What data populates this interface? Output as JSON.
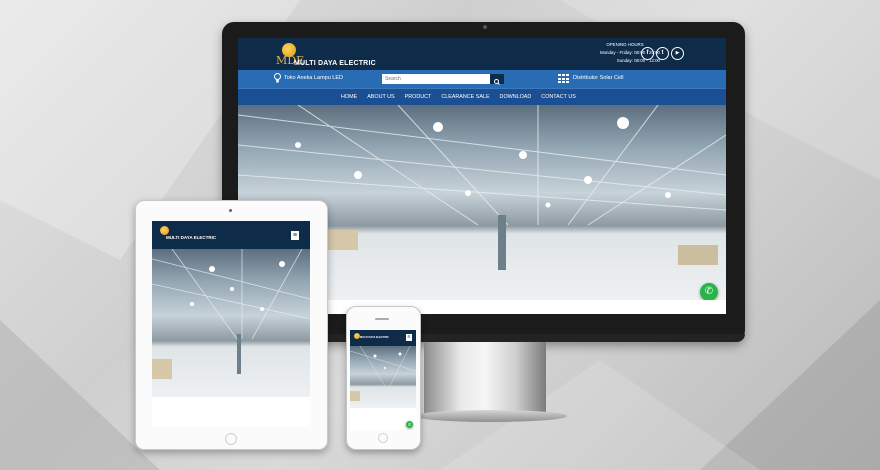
{
  "site": {
    "logo_mark": "MDE",
    "brand": "MULTI DAYA ELECTRIC",
    "opening_hours_title": "OPENING HOURS",
    "hours_weekday": "Monday - Friday: 08:00 - 20:00",
    "hours_sunday": "Sunday: 08:00 - 12:00",
    "social": [
      "facebook-icon",
      "twitter-icon",
      "youtube-icon"
    ],
    "tagline": "Toko Aneka Lampu LED",
    "search_placeholder": "Search",
    "solar_link": "Distributor Solar Cell",
    "nav": [
      "HOME",
      "ABOUT US",
      "PRODUCT",
      "CLEARANCE SALE",
      "DOWNLOAD",
      "CONTACT US"
    ]
  },
  "tablet": {
    "brand": "MULTI DAYA ELECTRIC",
    "menu_glyph": "≡"
  },
  "phone": {
    "brand": "MULTI DAYA ELECTRIC",
    "menu_glyph": "≡"
  },
  "colors": {
    "header": "#0e2b4a",
    "bar_blue": "#2a6cb3",
    "nav_blue": "#1b4f93",
    "whatsapp": "#28b446",
    "logo_gold": "#e3b24a"
  }
}
